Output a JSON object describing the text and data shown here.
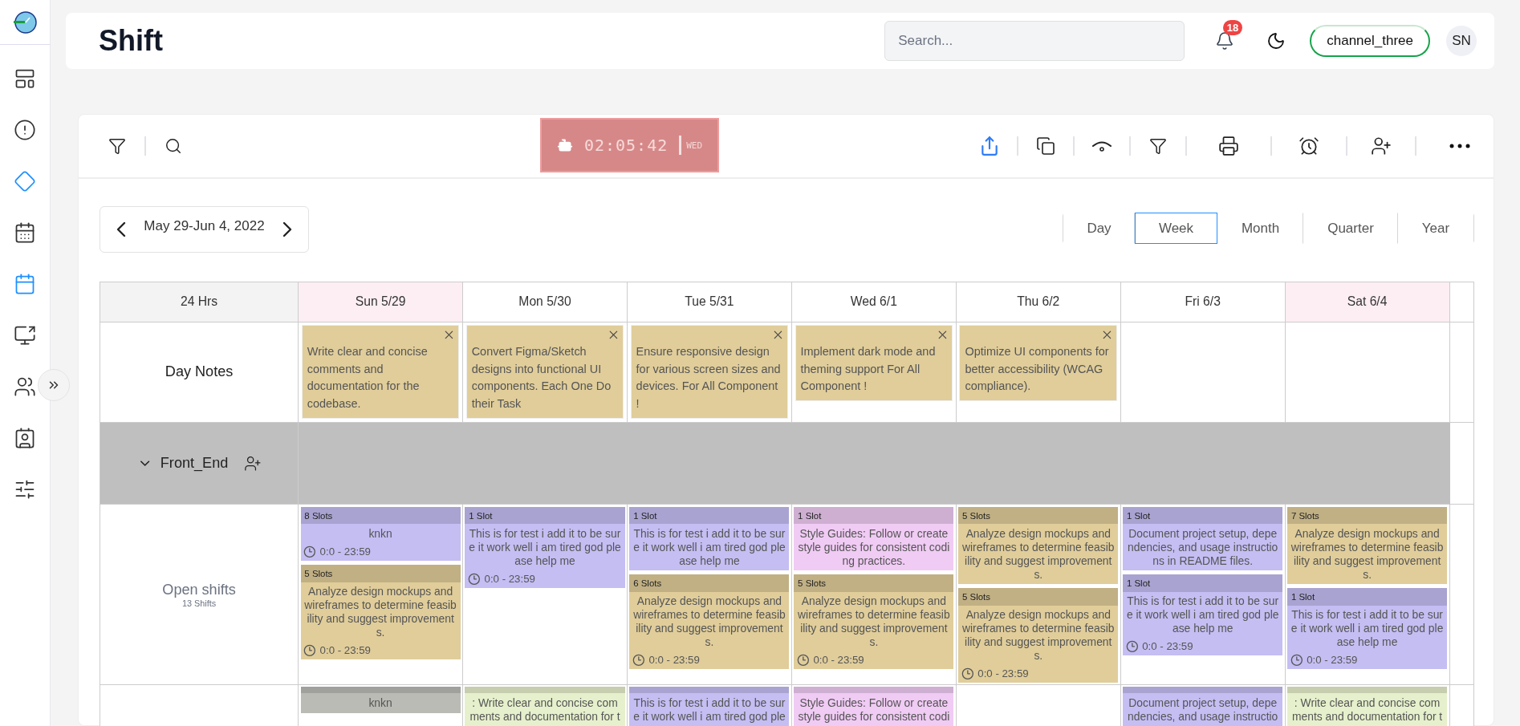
{
  "sidebar": {
    "items": [
      {
        "selected": false
      },
      {
        "selected": false
      },
      {
        "selected": true
      },
      {
        "selected": false
      },
      {
        "selected": true
      },
      {
        "selected": false
      },
      {
        "selected": false
      },
      {
        "selected": false
      },
      {
        "selected": false
      }
    ]
  },
  "header": {
    "title": "Shift",
    "search": {
      "placeholder": "Search..."
    },
    "notifications": "18",
    "channel": "channel_three",
    "avatar": "SN"
  },
  "toolbar": {
    "clock": {
      "time": "02:05:42",
      "day": "WED"
    }
  },
  "date_range": "May 29-Jun 4, 2022",
  "views": [
    {
      "label": "Day",
      "selected": false
    },
    {
      "label": "Week",
      "selected": true
    },
    {
      "label": "Month",
      "selected": false
    },
    {
      "label": "Quarter",
      "selected": false
    },
    {
      "label": "Year",
      "selected": false
    }
  ],
  "grid": {
    "corner": "24 Hrs",
    "day_notes_label": "Day Notes",
    "group": {
      "name": "Front_End",
      "expanded": true
    },
    "open_shifts": {
      "label": "Open shifts",
      "count": "13 Shifts"
    },
    "days": [
      {
        "label": "Sun 5/29",
        "weekend": true,
        "note": "Write clear and concise comments and documentation for the codebase.",
        "open_shifts": [
          {
            "slots": "8 Slots",
            "text": "knkn",
            "time": "0:0 - 23:59",
            "color": "#c4bef3"
          },
          {
            "slots": "5 Slots",
            "text": "Analyze design mockups and wireframes to determine feasibility and suggest improvements.",
            "time": "0:0 - 23:59",
            "color": "#e0cd9a"
          }
        ],
        "next_row": [
          {
            "text": "knkn",
            "color": "#babbb5"
          }
        ]
      },
      {
        "label": "Mon 5/30",
        "weekend": false,
        "note": "Convert Figma/Sketch designs into functional UI components. Each One Do their Task",
        "open_shifts": [
          {
            "slots": "1 Slot",
            "text": "This is for test i add it to be sure it work well i am tired god please help me",
            "time": "0:0 - 23:59",
            "color": "#c4bef3"
          }
        ],
        "next_row": [
          {
            "text": ": Write clear and concise comments and documentation for t",
            "color": "#e6f0cc"
          }
        ]
      },
      {
        "label": "Tue 5/31",
        "weekend": false,
        "note": "Ensure responsive design for various screen sizes and devices. For All Component !",
        "open_shifts": [
          {
            "slots": "1 Slot",
            "text": "This is for test i add it to be sure it work well i am tired god please help me",
            "color": "#c4bef3"
          },
          {
            "slots": "6 Slots",
            "text": "Analyze design mockups and wireframes to determine feasibility and suggest improvements.",
            "time": "0:0 - 23:59",
            "color": "#e0cd9a"
          }
        ],
        "next_row": [
          {
            "text": "This is for test i add it to be sure it work well i am tired god ple",
            "color": "#c4bef3"
          }
        ]
      },
      {
        "label": "Wed 6/1",
        "weekend": false,
        "note": "Implement dark mode and theming support For All Component !",
        "open_shifts": [
          {
            "slots": "1 Slot",
            "text": "Style Guides: Follow or create style guides for consistent coding practices.",
            "color": "#f0cbf4"
          },
          {
            "slots": "5 Slots",
            "text": "Analyze design mockups and wireframes to determine feasibility and suggest improvements.",
            "time": "0:0 - 23:59",
            "color": "#e0cd9a"
          }
        ],
        "next_row": [
          {
            "text": "Style Guides: Follow or create style guides for consistent codi",
            "color": "#f0cbf4"
          }
        ]
      },
      {
        "label": "Thu 6/2",
        "weekend": false,
        "note": "Optimize UI components for better accessibility (WCAG compliance).",
        "open_shifts": [
          {
            "slots": "5 Slots",
            "text": "Analyze design mockups and wireframes to determine feasibility and suggest improvements.",
            "color": "#e0cd9a"
          },
          {
            "slots": "5 Slots",
            "text": "Analyze design mockups and wireframes to determine feasibility and suggest improvements.",
            "time": "0:0 - 23:59",
            "color": "#e0cd9a"
          }
        ]
      },
      {
        "label": "Fri 6/3",
        "weekend": false,
        "open_shifts": [
          {
            "slots": "1 Slot",
            "text": "Document project setup, dependencies, and usage instructions in README files.",
            "color": "#c4bef3"
          },
          {
            "slots": "1 Slot",
            "text": "This is for test i add it to be sure it work well i am tired god please help me",
            "time": "0:0 - 23:59",
            "color": "#c4bef3"
          }
        ],
        "next_row": [
          {
            "text": "Document project setup, dependencies, and usage instructio",
            "color": "#c4bef3"
          }
        ]
      },
      {
        "label": "Sat 6/4",
        "weekend": true,
        "open_shifts": [
          {
            "slots": "7 Slots",
            "text": "Analyze design mockups and wireframes to determine feasibility and suggest improvements.",
            "color": "#e0cd9a"
          },
          {
            "slots": "1 Slot",
            "text": "This is for test i add it to be sure it work well i am tired god please help me",
            "time": "0:0 - 23:59",
            "color": "#c4bef3"
          }
        ],
        "next_row": [
          {
            "text": ": Write clear and concise comments and documentation for t",
            "color": "#e6f0cc"
          }
        ]
      }
    ]
  }
}
